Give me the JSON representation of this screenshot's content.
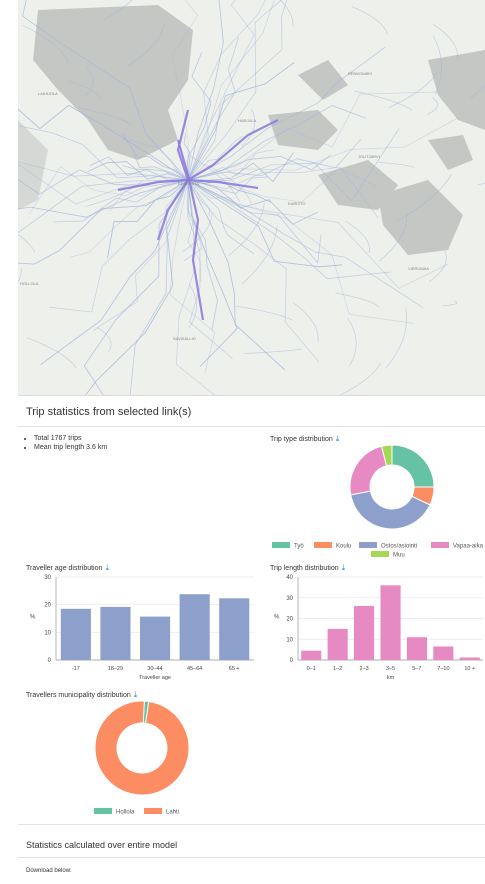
{
  "map": {
    "places": [
      "LAIHUOLA",
      "KESKUSTA",
      "HARJULA",
      "KARISTO",
      "JOUTJÄRVI",
      "RENKOMÄKI",
      "VIERUMAA",
      "SAVIKALLIO",
      "HOLLOLA"
    ],
    "colors": {
      "land": "#eef0ec",
      "water": "#c5c7c5",
      "roads": "#9fb4d8",
      "link": "#8877dd"
    }
  },
  "panel": {
    "title": "Trip statistics from selected link(s)",
    "summary": [
      "Total 1767 trips",
      "Mean trip length 3.6 km"
    ],
    "model_title": "Statistics calculated over entire model",
    "download_text": "Download below:"
  },
  "charts": {
    "trip_type": {
      "title": "Trip type distribution",
      "download_icon": "download-icon",
      "type": "pie",
      "labels": [
        "Työ",
        "Koulu",
        "Ostos/asiointi",
        "Vapaa-aika",
        "Muu"
      ],
      "values": [
        25,
        7,
        40,
        24,
        4
      ],
      "colors": [
        "#66c2a5",
        "#fc8d62",
        "#8da0cb",
        "#e78ac3",
        "#a6d854"
      ]
    },
    "traveller_age": {
      "title": "Traveller age distribution",
      "type": "bar",
      "categories": [
        "-17",
        "18–29",
        "30–44",
        "45–64",
        "65 +"
      ],
      "values": [
        18.5,
        19.2,
        15.7,
        23.8,
        22.3
      ],
      "xlabel": "Traveller age",
      "ylabel": "%",
      "yticks": [
        "0",
        "10",
        "20",
        "30"
      ],
      "ylim": [
        0,
        30
      ],
      "color": "#8da0cb"
    },
    "trip_length": {
      "title": "Trip length distribution",
      "type": "bar",
      "categories": [
        "0–1",
        "1–2",
        "2–3",
        "3–5",
        "5–7",
        "7–10",
        "10 +"
      ],
      "values": [
        4.5,
        15,
        26,
        36,
        11,
        6.5,
        1.2
      ],
      "xlabel": "km",
      "ylabel": "%",
      "yticks": [
        "0",
        "10",
        "20",
        "30",
        "40"
      ],
      "ylim": [
        0,
        40
      ],
      "color": "#e78ac3"
    },
    "municipality": {
      "title": "Travellers municipality distribution",
      "type": "pie",
      "labels": [
        "Hollola",
        "Lahti"
      ],
      "values": [
        1.5,
        98.5
      ],
      "colors": [
        "#66c2a5",
        "#fc8d62"
      ]
    }
  }
}
